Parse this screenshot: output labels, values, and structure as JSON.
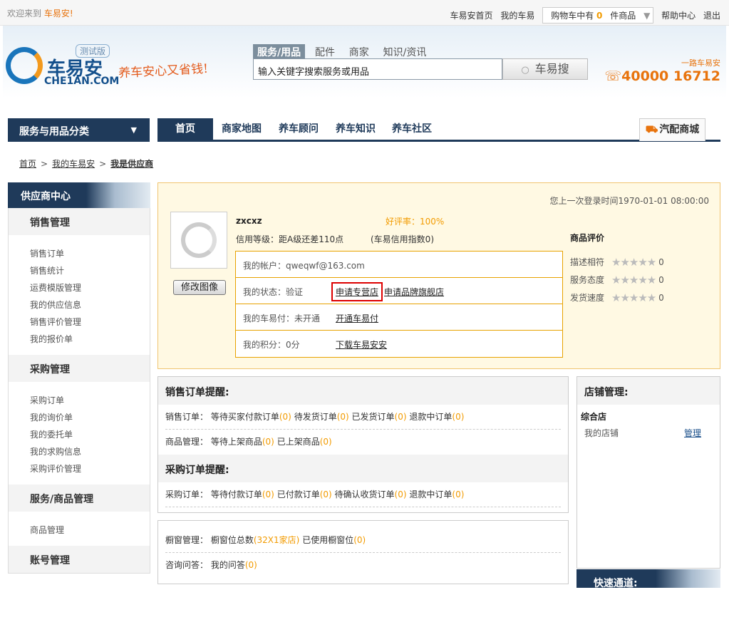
{
  "topbar": {
    "welcome": "欢迎来到",
    "brand": "车易安!",
    "links": [
      "车易安首页",
      "我的车易"
    ],
    "cart_prefix": "购物车中有",
    "cart_count": "0",
    "cart_suffix": "件商品",
    "help": "帮助中心",
    "logout": "退出"
  },
  "header": {
    "logo_name": "车易安",
    "logo_domain": "CHE1AN.COM",
    "beta": "测试版",
    "slogan": "养车安心又省钱!",
    "search_tabs": [
      "服务/用品",
      "配件",
      "商家",
      "知识/资讯"
    ],
    "search_placeholder": "输入关键字搜索服务或用品",
    "search_button": "车易搜",
    "hotline_slogan": "一路车易安",
    "hotline_number": "40000 16712"
  },
  "nav": {
    "category": "服务与用品分类",
    "items": [
      "首页",
      "商家地图",
      "养车顾问",
      "养车知识",
      "养车社区"
    ],
    "mall": "汽配商城"
  },
  "breadcrumb": [
    "首页",
    "我的车易安",
    "我是供应商"
  ],
  "sidebar": {
    "title": "供应商中心",
    "groups": [
      {
        "title": "销售管理",
        "items": [
          "销售订单",
          "销售统计",
          "运费模版管理",
          "我的供应信息",
          "销售评价管理",
          "我的报价单"
        ]
      },
      {
        "title": "采购管理",
        "items": [
          "采购订单",
          "我的询价单",
          "我的委托单",
          "我的求购信息",
          "采购评价管理"
        ]
      },
      {
        "title": "服务/商品管理",
        "items": [
          "商品管理"
        ]
      },
      {
        "title": "账号管理",
        "items": []
      }
    ]
  },
  "profile": {
    "last_login": "您上一次登录时间1970-01-01 08:00:00",
    "edit_avatar": "修改图像",
    "username": "zxcxz",
    "rating": "好评率：100%",
    "credit_level": "信用等级：距A级还差110点",
    "credit_index": "(车易信用指数0)",
    "rows": [
      {
        "label": "我的帐户：qweqwf@163.com",
        "links": []
      },
      {
        "label": "我的状态：验证",
        "links": [
          "申请专营店",
          "申请品牌旗舰店"
        ]
      },
      {
        "label": "我的车易付：未开通",
        "links": [
          "开通车易付"
        ]
      },
      {
        "label": "我的积分：0分",
        "links": [
          "下载车易安安"
        ]
      }
    ],
    "eval_title": "商品评价",
    "eval_rows": [
      {
        "label": "描述相符",
        "score": "0"
      },
      {
        "label": "服务态度",
        "score": "0"
      },
      {
        "label": "发货速度",
        "score": "0"
      }
    ]
  },
  "sales_reminder": {
    "title": "销售订单提醒:",
    "order_prefix": "销售订单：",
    "orders": [
      {
        "label": "等待买家付款订单",
        "count": "(0)"
      },
      {
        "label": "待发货订单",
        "count": "(0)"
      },
      {
        "label": "已发货订单",
        "count": "(0)"
      },
      {
        "label": "退款中订单",
        "count": "(0)"
      }
    ],
    "goods_prefix": "商品管理：",
    "goods": [
      {
        "label": "等待上架商品",
        "count": "(0)"
      },
      {
        "label": "已上架商品",
        "count": "(0)"
      }
    ]
  },
  "purchase_reminder": {
    "title": "采购订单提醒:",
    "prefix": "采购订单：",
    "orders": [
      {
        "label": "等待付款订单",
        "count": "(0)"
      },
      {
        "label": "已付款订单",
        "count": "(0)"
      },
      {
        "label": "待确认收货订单",
        "count": "(0)"
      },
      {
        "label": "退款中订单",
        "count": "(0)"
      }
    ]
  },
  "window_box": {
    "prefix": "橱窗管理：",
    "total_label": "橱窗位总数",
    "total_value": "(32X1家店)",
    "used_label": "已使用橱窗位",
    "used_value": "(0)",
    "qa_prefix": "咨询问答：",
    "qa_label": "我的问答",
    "qa_value": "(0)"
  },
  "shop": {
    "title": "店铺管理:",
    "type": "综合店",
    "my_shop": "我的店铺",
    "manage": "管理",
    "quick": "快速通道:"
  }
}
